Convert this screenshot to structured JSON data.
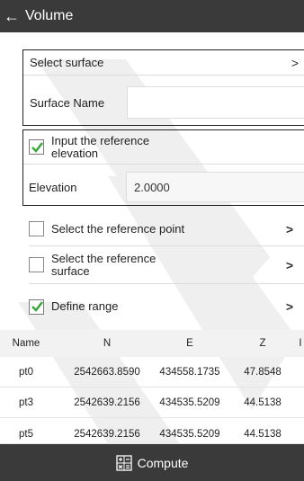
{
  "header": {
    "title": "Volume",
    "back_icon": "arrow-left-icon"
  },
  "surface": {
    "select_label": "Select surface",
    "name_label": "Surface Name",
    "name_value": ""
  },
  "reference": {
    "input_label": "Input the reference elevation",
    "input_checked": true,
    "elevation_label": "Elevation",
    "elevation_value": "2.0000"
  },
  "options": [
    {
      "label": "Select the reference point",
      "checked": false
    },
    {
      "label": "Select the reference surface",
      "checked": false
    },
    {
      "label": "Define range",
      "checked": true
    }
  ],
  "table": {
    "headers": [
      "Name",
      "N",
      "E",
      "Z",
      "I"
    ],
    "rows": [
      [
        "pt0",
        "2542663.8590",
        "434558.1735",
        "47.8548"
      ],
      [
        "pt3",
        "2542639.2156",
        "434535.5209",
        "44.5138"
      ],
      [
        "pt5",
        "2542639.2156",
        "434535.5209",
        "44.5138"
      ]
    ]
  },
  "footer": {
    "compute_label": "Compute",
    "compute_icon": "calculator-icon"
  },
  "colors": {
    "bar": "#3a3a3a",
    "check": "#3aa63a",
    "border": "#222222"
  }
}
